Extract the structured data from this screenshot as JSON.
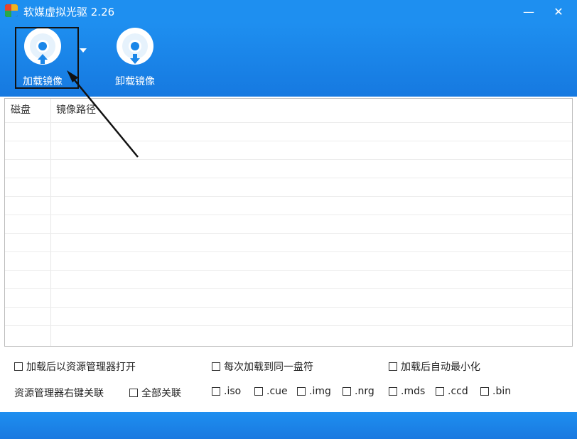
{
  "window": {
    "title": "软媒虚拟光驱 2.26",
    "minimize_glyph": "—",
    "close_glyph": "✕"
  },
  "toolbar": {
    "mount_label": "加载镜像",
    "unmount_label": "卸载镜像",
    "mount_icon": "disc-mount-icon",
    "unmount_icon": "disc-unmount-icon"
  },
  "table": {
    "columns": [
      "磁盘",
      "镜像路径"
    ],
    "rows": []
  },
  "options": {
    "open_in_explorer": "加载后以资源管理器打开",
    "same_drive_letter": "每次加载到同一盘符",
    "auto_minimize": "加载后自动最小化",
    "context_menu_label": "资源管理器右键关联",
    "associate_all": "全部关联",
    "extensions": [
      ".iso",
      ".cue",
      ".img",
      ".nrg",
      ".mds",
      ".ccd",
      ".bin"
    ]
  },
  "colors": {
    "accent": "#1e8ff0",
    "accent_dark": "#1679e0"
  }
}
